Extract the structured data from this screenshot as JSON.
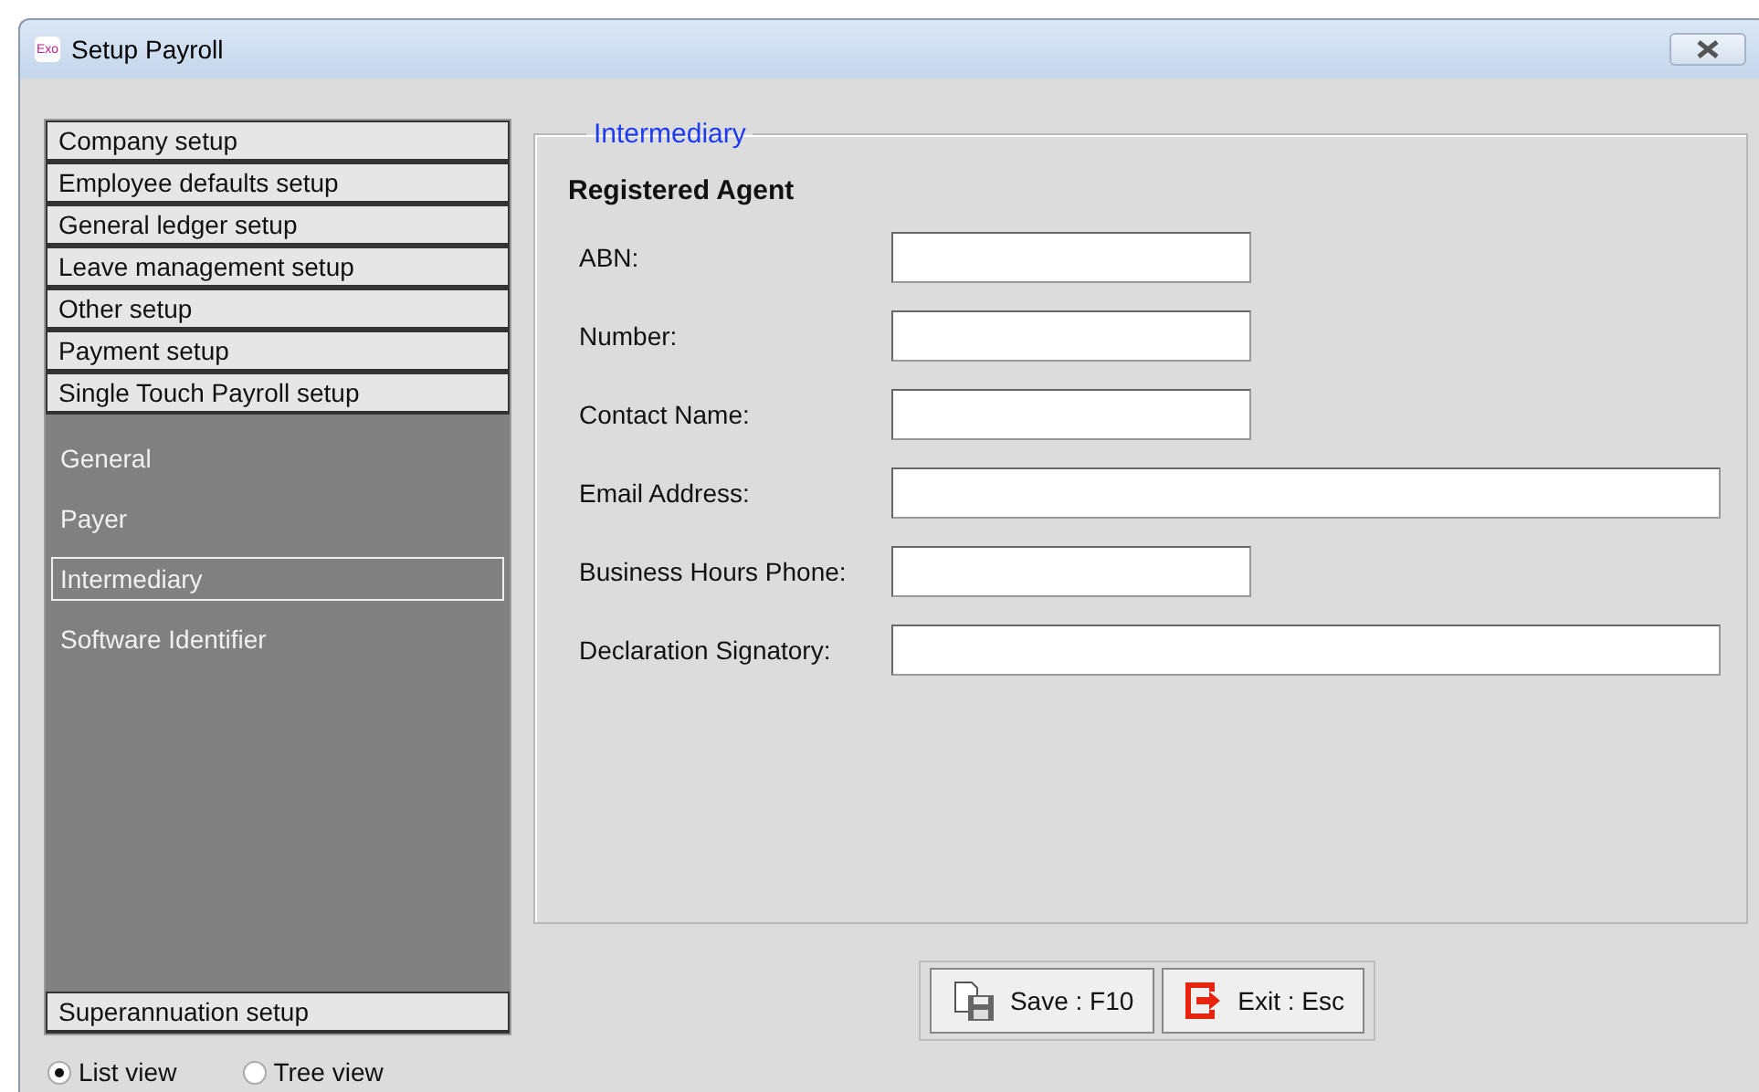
{
  "window": {
    "title": "Setup Payroll",
    "icon_text": "Exo"
  },
  "sidebar": {
    "sections": [
      {
        "label": "Company setup"
      },
      {
        "label": "Employee defaults setup"
      },
      {
        "label": "General ledger setup"
      },
      {
        "label": "Leave management setup"
      },
      {
        "label": "Other setup"
      },
      {
        "label": "Payment setup"
      },
      {
        "label": "Single Touch Payroll setup",
        "children": [
          {
            "label": "General",
            "selected": false
          },
          {
            "label": "Payer",
            "selected": false
          },
          {
            "label": "Intermediary",
            "selected": true
          },
          {
            "label": "Software Identifier",
            "selected": false
          }
        ]
      },
      {
        "label": "Superannuation setup"
      }
    ]
  },
  "view_options": [
    {
      "label": "List view",
      "selected": true
    },
    {
      "label": "Tree view",
      "selected": false
    }
  ],
  "panel": {
    "legend": "Intermediary",
    "heading": "Registered Agent",
    "fields": [
      {
        "label": "ABN:",
        "kind": "short"
      },
      {
        "label": "Number:",
        "kind": "short"
      },
      {
        "label": "Contact Name:",
        "kind": "short"
      },
      {
        "label": "Email Address:",
        "kind": "long"
      },
      {
        "label": "Business Hours Phone:",
        "kind": "short"
      },
      {
        "label": "Declaration Signatory:",
        "kind": "long"
      }
    ]
  },
  "buttons": [
    {
      "label": "Save : F10",
      "kind": "save"
    },
    {
      "label": "Exit : Esc",
      "kind": "exit"
    }
  ]
}
